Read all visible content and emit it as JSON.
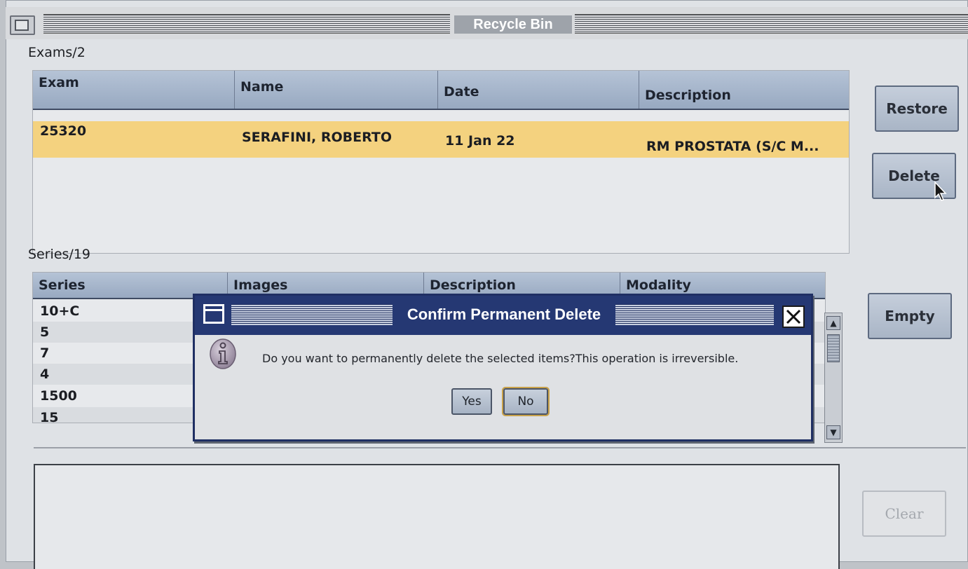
{
  "window": {
    "title": "Recycle Bin"
  },
  "exams": {
    "label": "Exams/2",
    "columns": [
      "Exam",
      "Name",
      "Date",
      "Description"
    ],
    "rows": [
      {
        "exam": "25320",
        "name": "SERAFINI, ROBERTO",
        "date": "11 Jan 22",
        "description": "RM PROSTATA (S/C M...",
        "selected": true
      }
    ]
  },
  "series": {
    "label": "Series/19",
    "columns": [
      "Series",
      "Images",
      "Description",
      "Modality"
    ],
    "rows": [
      "10+C",
      "5",
      "7",
      "4",
      "1500",
      "15"
    ]
  },
  "buttons": {
    "restore": "Restore",
    "delete": "Delete",
    "empty": "Empty",
    "clear": "Clear"
  },
  "dialog": {
    "title": "Confirm Permanent Delete",
    "message": "Do you want to permanently delete the selected items?This operation is irreversible.",
    "yes": "Yes",
    "no": "No",
    "icon": "info-icon"
  },
  "colors": {
    "selection": "#f4d27f",
    "header": "#a3b3c9",
    "dialog_title": "#253873"
  }
}
